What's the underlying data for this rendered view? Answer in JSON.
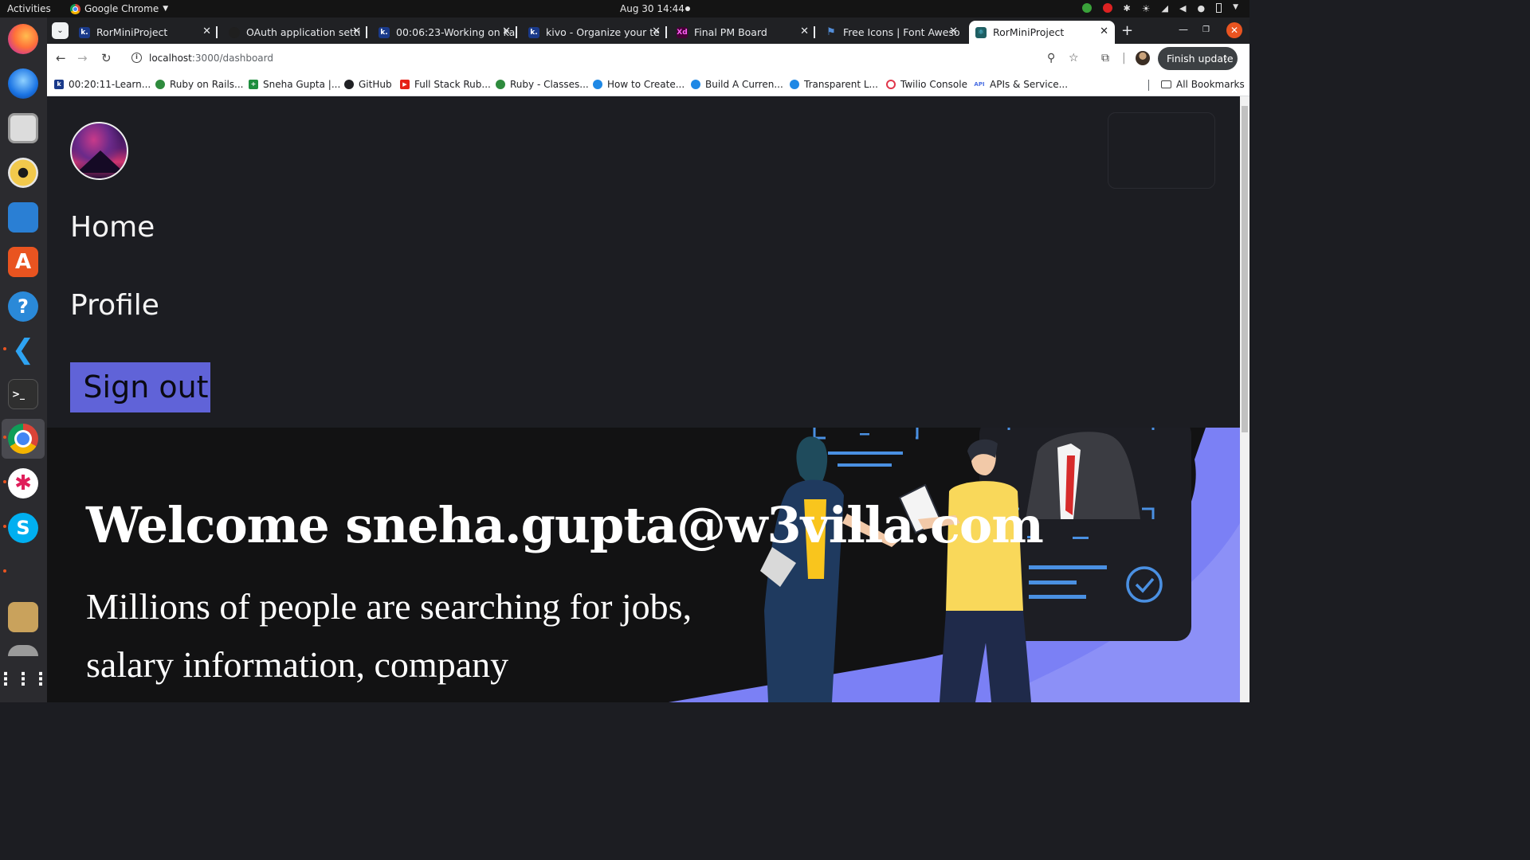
{
  "system_bar": {
    "activities": "Activities",
    "app_name": "Google Chrome",
    "clock": "Aug 30  14:44"
  },
  "browser": {
    "tabs": [
      {
        "title": "RorMiniProject",
        "favicon": "kivo-k-icon",
        "active": false
      },
      {
        "title": "OAuth application setti",
        "favicon": "github-icon",
        "active": false
      },
      {
        "title": "00:06:23-Working on ka",
        "favicon": "kivo-k-icon",
        "active": false
      },
      {
        "title": "kivo - Organize your te",
        "favicon": "kivo-k-icon",
        "active": false
      },
      {
        "title": "Final PM Board",
        "favicon": "adobe-xd-icon",
        "active": false
      },
      {
        "title": "Free Icons | Font Aweso",
        "favicon": "font-awesome-flag-icon",
        "active": false
      },
      {
        "title": "RorMiniProject",
        "favicon": "react-icon",
        "active": true
      }
    ],
    "url_host": "localhost",
    "url_path": ":3000/dashboard",
    "finish_update": "Finish update",
    "bookmarks": [
      {
        "label": "00:20:11-Learn...",
        "icon": "kivo-k-icon",
        "color": "#1a3a8a"
      },
      {
        "label": "Ruby on Rails...",
        "icon": "ruby-gem-icon",
        "color": "#2e8b3d"
      },
      {
        "label": "Sneha Gupta |...",
        "icon": "sheets-icon",
        "color": "#1e8e3e"
      },
      {
        "label": "GitHub",
        "icon": "github-icon",
        "color": "#202124"
      },
      {
        "label": "Full Stack Rub...",
        "icon": "youtube-icon",
        "color": "#e62117"
      },
      {
        "label": "Ruby - Classes...",
        "icon": "ruby-gem-icon",
        "color": "#2e8b3d"
      },
      {
        "label": "How to Create...",
        "icon": "blog-icon",
        "color": "#1e88e5"
      },
      {
        "label": "Build A Curren...",
        "icon": "blog-icon",
        "color": "#1e88e5"
      },
      {
        "label": "Transparent L...",
        "icon": "blog-icon",
        "color": "#1e88e5"
      },
      {
        "label": "Twilio Console",
        "icon": "twilio-icon",
        "color": "#e0364a"
      },
      {
        "label": "APIs & Service...",
        "icon": "api-icon",
        "color": "#4b6fe3"
      }
    ],
    "all_bookmarks": "All Bookmarks"
  },
  "page": {
    "nav": {
      "home": "Home",
      "profile": "Profile",
      "sign_out": "Sign out"
    },
    "hero": {
      "welcome": "Welcome sneha.gupta@w3villa.com",
      "tagline": "Millions of people are searching for jobs, salary information, company"
    }
  },
  "colors": {
    "nav_bg": "#1c1d22",
    "hero_bg": "#121213",
    "signout_bg": "#6063d8",
    "illustration_accent": "#7b80f5"
  }
}
